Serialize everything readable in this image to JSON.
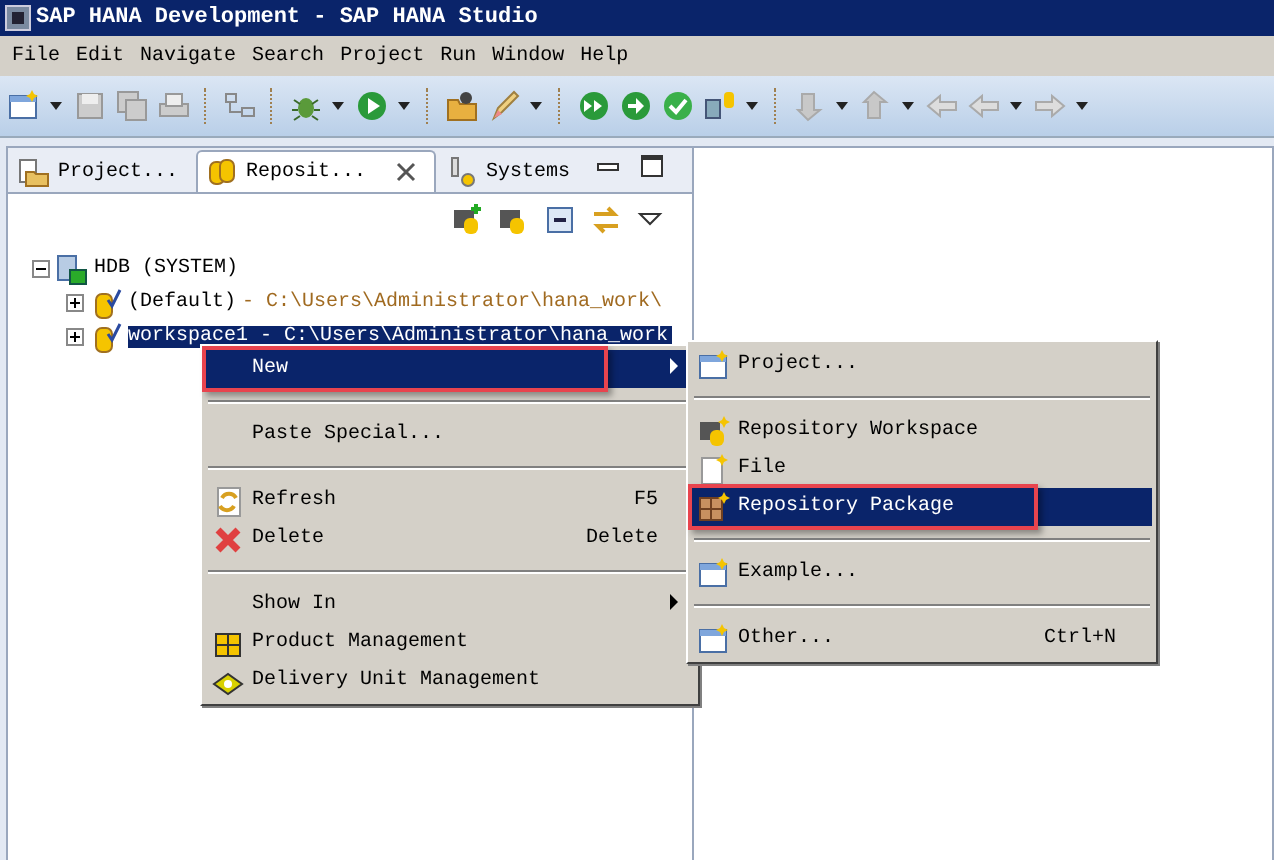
{
  "window": {
    "title": "SAP HANA Development - SAP HANA Studio"
  },
  "menu_bar": [
    "File",
    "Edit",
    "Navigate",
    "Search",
    "Project",
    "Run",
    "Window",
    "Help"
  ],
  "view_tabs": [
    {
      "label": "Project...",
      "selected": false,
      "closable": false
    },
    {
      "label": "Reposit...",
      "selected": true,
      "closable": true
    },
    {
      "label": "Systems",
      "selected": false,
      "closable": false
    }
  ],
  "tree": [
    {
      "label": "HDB (SYSTEM)",
      "expanded": true,
      "selected": false,
      "children": [
        {
          "label": "(Default)",
          "path": "- C:\\Users\\Administrator\\hana_work\\",
          "expanded": false,
          "selected": false
        },
        {
          "label": "workspace1",
          "path": "- C:\\Users\\Administrator\\hana_work",
          "expanded": false,
          "selected": true
        }
      ]
    }
  ],
  "context_menu": {
    "items": [
      {
        "kind": "item",
        "label": "New",
        "submenu": true,
        "selected": true,
        "outlined": true
      },
      {
        "kind": "separator"
      },
      {
        "kind": "item",
        "label": "Paste Special...",
        "submenu": false,
        "selected": false,
        "outlined": false
      },
      {
        "kind": "separator"
      },
      {
        "kind": "item",
        "label": "Refresh",
        "shortcut": "F5",
        "submenu": false,
        "selected": false,
        "outlined": false
      },
      {
        "kind": "item",
        "label": "Delete",
        "shortcut": "Delete",
        "submenu": false,
        "selected": false,
        "outlined": false
      },
      {
        "kind": "separator"
      },
      {
        "kind": "item",
        "label": "Show In",
        "submenu": true,
        "selected": false,
        "outlined": false
      },
      {
        "kind": "item",
        "label": "Product Management",
        "submenu": false,
        "selected": false,
        "outlined": false
      },
      {
        "kind": "item",
        "label": "Delivery Unit Management",
        "submenu": false,
        "selected": false,
        "outlined": false
      }
    ]
  },
  "submenu": {
    "items": [
      {
        "kind": "item",
        "label": "Project...",
        "submenu": false,
        "selected": false,
        "outlined": false
      },
      {
        "kind": "separator"
      },
      {
        "kind": "item",
        "label": "Repository Workspace",
        "submenu": false,
        "selected": false,
        "outlined": false
      },
      {
        "kind": "item",
        "label": "File",
        "submenu": false,
        "selected": false,
        "outlined": false
      },
      {
        "kind": "item",
        "label": "Repository Package",
        "submenu": false,
        "selected": true,
        "outlined": true
      },
      {
        "kind": "separator"
      },
      {
        "kind": "item",
        "label": "Example...",
        "submenu": false,
        "selected": false,
        "outlined": false
      },
      {
        "kind": "separator"
      },
      {
        "kind": "item",
        "label": "Other...",
        "shortcut": "Ctrl+N",
        "submenu": false,
        "selected": false,
        "outlined": false
      }
    ]
  }
}
